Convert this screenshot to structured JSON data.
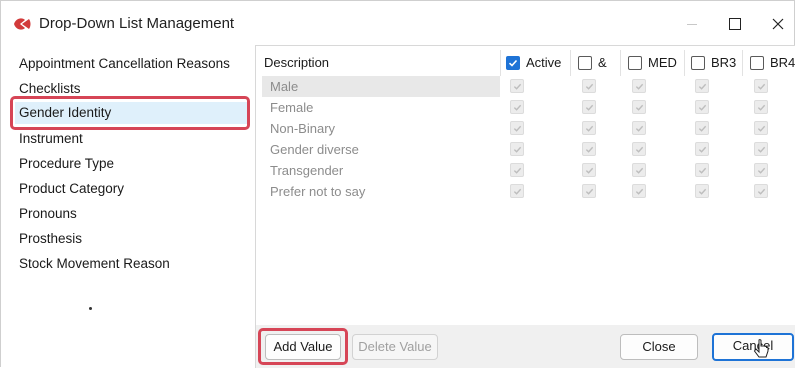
{
  "window": {
    "title": "Drop-Down List Management",
    "controls": [
      "minimize-icon",
      "maximize-icon",
      "close-icon"
    ],
    "brand_color": "#d23a3a"
  },
  "lists": {
    "items": [
      {
        "label": "Appointment Cancellation Reasons"
      },
      {
        "label": "Checklists"
      },
      {
        "label": "Gender Identity",
        "selected": true
      },
      {
        "label": "Instrument"
      },
      {
        "label": "Procedure Type"
      },
      {
        "label": "Product Category"
      },
      {
        "label": "Pronouns"
      },
      {
        "label": "Prosthesis"
      },
      {
        "label": "Stock Movement Reason"
      }
    ]
  },
  "grid": {
    "columns": [
      {
        "label": "Description"
      },
      {
        "label": "Active",
        "checked": true
      },
      {
        "label": "&",
        "checked": false
      },
      {
        "label": "MED",
        "checked": false
      },
      {
        "label": "BR3",
        "checked": false
      },
      {
        "label": "BR4",
        "checked": false
      }
    ],
    "rows": [
      {
        "description": "Male",
        "checks": [
          true,
          true,
          true,
          true,
          true
        ]
      },
      {
        "description": "Female",
        "checks": [
          true,
          true,
          true,
          true,
          true
        ]
      },
      {
        "description": "Non-Binary",
        "checks": [
          true,
          true,
          true,
          true,
          true
        ]
      },
      {
        "description": "Gender diverse",
        "checks": [
          true,
          true,
          true,
          true,
          true
        ]
      },
      {
        "description": "Transgender",
        "checks": [
          true,
          true,
          true,
          true,
          true
        ]
      },
      {
        "description": "Prefer not to say",
        "checks": [
          true,
          true,
          true,
          true,
          true
        ]
      }
    ]
  },
  "footer": {
    "add_value": "Add Value",
    "delete_value": "Delete Value",
    "close": "Close",
    "cancel": "Cancel"
  },
  "colors": {
    "accent": "#1e73d6",
    "highlight": "#d64556",
    "selection": "#dff0fb"
  }
}
